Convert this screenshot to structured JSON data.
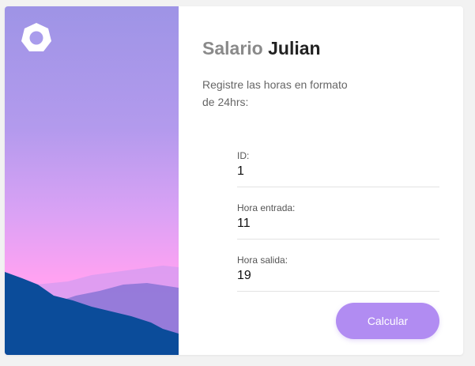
{
  "form": {
    "title_prefix": "Salario",
    "title_name": "Julian",
    "subtitle": "Registre las horas en formato de 24hrs:",
    "fields": [
      {
        "label": "ID:",
        "value": "1"
      },
      {
        "label": "Hora entrada:",
        "value": "11"
      },
      {
        "label": "Hora salida:",
        "value": "19"
      }
    ],
    "submit_label": "Calcular"
  },
  "colors": {
    "accent": "#b18cf2",
    "title": "#222222",
    "title_muted": "#8a8a8a",
    "mountain_front": "#0b4c9a",
    "sky_top": "#9e94e6",
    "sky_bottom": "#ffa2f2"
  },
  "icons": {
    "logo": "heptagon-ring-logo-icon"
  }
}
